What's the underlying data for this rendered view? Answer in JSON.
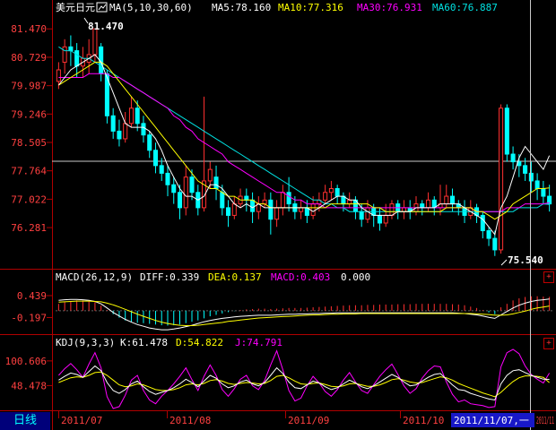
{
  "main": {
    "title": "美元日元",
    "ma_label": "MA(5,10,30,60)",
    "ma5": "MA5:78.160",
    "ma10": "MA10:77.316",
    "ma30": "MA30:76.931",
    "ma60": "MA60:76.887",
    "y_ticks": [
      "81.470",
      "80.729",
      "79.987",
      "79.246",
      "78.505",
      "77.764",
      "77.022",
      "76.281"
    ],
    "high_label": "81.470",
    "low_label": "75.540",
    "ylim": [
      75.3,
      81.85
    ]
  },
  "macd": {
    "label": "MACD(26,12,9)",
    "diff": "DIFF:0.339",
    "dea": "DEA:0.137",
    "macd_val": "MACD:0.403",
    "zero": "0.000",
    "y_ticks": [
      "0.439",
      "-0.197"
    ],
    "ylim": [
      -0.6,
      0.75
    ]
  },
  "kdj": {
    "label": "KDJ(9,3,3)",
    "k": "K:61.478",
    "d": "D:54.822",
    "j": "J:74.791",
    "y_ticks": [
      "100.606",
      "48.478"
    ],
    "ylim": [
      0,
      125
    ]
  },
  "footer": {
    "period_tab": "日线",
    "dates": [
      "2011/07",
      "2011/08",
      "2011/09",
      "2011/10",
      "2011/11"
    ],
    "cursor_date": "2011/11/07,一"
  },
  "panel_buttons": {
    "expand": "+"
  },
  "colors": {
    "up": "#ff3030",
    "down": "#00ffff",
    "ma5": "#ffffff",
    "ma10": "#ffff00",
    "ma30": "#ff00ff",
    "ma60": "#00e0e0",
    "axis": "#b00000",
    "title": "#ffffff"
  },
  "chart_data": {
    "type": "candlestick",
    "ohlc": [
      [
        80.1,
        80.4,
        79.9,
        80.6
      ],
      [
        80.6,
        81.0,
        80.3,
        81.2
      ],
      [
        81.0,
        80.9,
        80.5,
        81.3
      ],
      [
        80.9,
        80.5,
        80.2,
        81.1
      ],
      [
        80.5,
        80.7,
        80.2,
        81.0
      ],
      [
        80.6,
        80.8,
        80.3,
        81.2
      ],
      [
        80.8,
        81.47,
        80.6,
        81.47
      ],
      [
        81.0,
        80.3,
        80.1,
        81.1
      ],
      [
        80.3,
        79.2,
        79.0,
        80.4
      ],
      [
        79.2,
        78.8,
        78.6,
        79.4
      ],
      [
        78.8,
        78.6,
        78.4,
        79.1
      ],
      [
        78.6,
        79.0,
        78.5,
        79.3
      ],
      [
        79.0,
        79.4,
        78.9,
        79.7
      ],
      [
        79.4,
        79.0,
        78.8,
        79.6
      ],
      [
        79.0,
        78.7,
        78.5,
        79.2
      ],
      [
        78.7,
        78.3,
        78.1,
        78.8
      ],
      [
        78.3,
        77.9,
        77.7,
        78.5
      ],
      [
        77.9,
        77.7,
        77.5,
        78.1
      ],
      [
        77.7,
        77.4,
        77.1,
        77.9
      ],
      [
        77.4,
        77.2,
        76.9,
        77.6
      ],
      [
        77.2,
        76.8,
        76.5,
        77.4
      ],
      [
        76.8,
        77.6,
        76.6,
        77.9
      ],
      [
        77.6,
        77.2,
        77.0,
        77.8
      ],
      [
        77.2,
        76.8,
        76.6,
        77.4
      ],
      [
        76.8,
        77.5,
        76.7,
        79.7
      ],
      [
        77.5,
        77.8,
        77.3,
        78.0
      ],
      [
        77.6,
        77.3,
        77.0,
        77.9
      ],
      [
        77.2,
        76.8,
        76.6,
        77.4
      ],
      [
        76.8,
        76.6,
        76.3,
        77.0
      ],
      [
        76.6,
        76.9,
        76.5,
        77.1
      ],
      [
        76.9,
        77.1,
        76.8,
        77.3
      ],
      [
        77.1,
        77.0,
        76.7,
        77.3
      ],
      [
        77.0,
        76.7,
        76.4,
        77.2
      ],
      [
        76.7,
        76.9,
        76.5,
        77.1
      ],
      [
        76.9,
        77.0,
        76.8,
        77.2
      ],
      [
        77.0,
        76.5,
        76.1,
        77.2
      ],
      [
        76.5,
        76.8,
        76.3,
        77.0
      ],
      [
        76.8,
        77.2,
        76.6,
        77.4
      ],
      [
        77.2,
        76.9,
        76.7,
        77.6
      ],
      [
        76.9,
        76.7,
        76.5,
        77.1
      ],
      [
        76.7,
        76.8,
        76.5,
        77.0
      ],
      [
        76.8,
        76.6,
        76.4,
        77.0
      ],
      [
        76.6,
        76.9,
        76.5,
        77.1
      ],
      [
        76.9,
        77.0,
        76.7,
        77.2
      ],
      [
        77.0,
        77.2,
        76.9,
        77.4
      ],
      [
        77.2,
        77.3,
        77.0,
        77.5
      ],
      [
        77.3,
        77.1,
        76.9,
        77.4
      ],
      [
        77.1,
        76.9,
        76.7,
        77.2
      ],
      [
        76.9,
        77.0,
        76.8,
        77.2
      ],
      [
        77.0,
        76.7,
        76.5,
        77.1
      ],
      [
        76.7,
        76.5,
        76.3,
        76.9
      ],
      [
        76.5,
        76.8,
        76.4,
        77.0
      ],
      [
        76.8,
        76.6,
        76.3,
        76.9
      ],
      [
        76.6,
        76.4,
        76.2,
        76.8
      ],
      [
        76.4,
        76.6,
        76.3,
        76.9
      ],
      [
        76.6,
        76.9,
        76.5,
        77.0
      ],
      [
        76.9,
        76.7,
        76.5,
        77.0
      ],
      [
        76.7,
        76.8,
        76.5,
        77.0
      ],
      [
        76.8,
        76.7,
        76.5,
        77.0
      ],
      [
        76.7,
        76.9,
        76.6,
        77.1
      ],
      [
        76.9,
        76.8,
        76.6,
        77.0
      ],
      [
        76.8,
        77.0,
        76.7,
        77.2
      ],
      [
        77.0,
        76.8,
        76.6,
        77.1
      ],
      [
        76.8,
        76.9,
        76.6,
        77.4
      ],
      [
        76.9,
        77.1,
        76.8,
        77.4
      ],
      [
        77.1,
        76.9,
        76.7,
        77.3
      ],
      [
        76.9,
        76.8,
        76.6,
        77.0
      ],
      [
        76.8,
        76.6,
        76.4,
        77.0
      ],
      [
        76.6,
        76.8,
        76.5,
        77.0
      ],
      [
        76.8,
        76.6,
        76.4,
        76.9
      ],
      [
        76.6,
        76.2,
        76.0,
        76.7
      ],
      [
        76.2,
        76.0,
        75.8,
        76.3
      ],
      [
        76.0,
        75.7,
        75.54,
        76.2
      ],
      [
        75.7,
        79.4,
        75.6,
        79.5
      ],
      [
        79.4,
        78.2,
        78.0,
        79.5
      ],
      [
        78.2,
        78.0,
        77.8,
        78.4
      ],
      [
        78.0,
        77.9,
        77.6,
        78.2
      ],
      [
        77.9,
        77.7,
        77.5,
        78.1
      ],
      [
        77.7,
        77.5,
        77.2,
        78.0
      ],
      [
        77.5,
        77.3,
        77.0,
        77.7
      ],
      [
        77.3,
        77.1,
        76.9,
        77.5
      ],
      [
        77.1,
        76.9,
        76.7,
        77.4
      ]
    ],
    "ma5": [
      80.0,
      80.2,
      80.4,
      80.5,
      80.6,
      80.7,
      80.8,
      80.6,
      80.2,
      79.8,
      79.4,
      79.0,
      78.9,
      78.9,
      78.9,
      78.8,
      78.6,
      78.3,
      77.9,
      77.6,
      77.3,
      77.1,
      77.1,
      77.0,
      77.1,
      77.4,
      77.4,
      77.3,
      77.1,
      76.9,
      76.8,
      76.9,
      76.8,
      76.9,
      76.8,
      76.8,
      76.8,
      76.8,
      76.8,
      76.8,
      76.8,
      76.8,
      76.7,
      76.8,
      76.9,
      77.0,
      77.1,
      77.1,
      77.0,
      77.0,
      76.8,
      76.7,
      76.6,
      76.6,
      76.6,
      76.6,
      76.7,
      76.7,
      76.7,
      76.8,
      76.8,
      76.8,
      76.8,
      76.9,
      76.9,
      76.9,
      76.9,
      76.8,
      76.7,
      76.6,
      76.5,
      76.3,
      76.1,
      76.8,
      77.1,
      77.6,
      78.1,
      78.4,
      78.2,
      78.0,
      77.8,
      78.16
    ],
    "ma10": [
      80.0,
      80.1,
      80.2,
      80.3,
      80.4,
      80.5,
      80.6,
      80.6,
      80.5,
      80.3,
      80.1,
      79.9,
      79.7,
      79.5,
      79.3,
      79.1,
      78.9,
      78.7,
      78.5,
      78.3,
      78.1,
      77.9,
      77.7,
      77.5,
      77.4,
      77.3,
      77.3,
      77.2,
      77.1,
      77.1,
      77.0,
      77.0,
      77.0,
      76.9,
      76.9,
      76.8,
      76.8,
      76.8,
      76.8,
      76.8,
      76.8,
      76.8,
      76.8,
      76.8,
      76.8,
      76.9,
      76.9,
      76.9,
      76.9,
      76.9,
      76.9,
      76.9,
      76.8,
      76.8,
      76.7,
      76.7,
      76.7,
      76.7,
      76.7,
      76.7,
      76.7,
      76.7,
      76.7,
      76.7,
      76.8,
      76.8,
      76.8,
      76.8,
      76.8,
      76.7,
      76.7,
      76.6,
      76.5,
      76.6,
      76.7,
      76.9,
      77.0,
      77.1,
      77.2,
      77.3,
      77.3,
      77.316
    ],
    "ma30": [
      80.2,
      80.2,
      80.2,
      80.2,
      80.2,
      80.3,
      80.3,
      80.3,
      80.3,
      80.2,
      80.2,
      80.1,
      80.0,
      79.9,
      79.8,
      79.7,
      79.6,
      79.5,
      79.4,
      79.2,
      79.1,
      78.9,
      78.8,
      78.6,
      78.5,
      78.4,
      78.3,
      78.2,
      78.0,
      77.9,
      77.8,
      77.7,
      77.6,
      77.5,
      77.4,
      77.3,
      77.2,
      77.2,
      77.1,
      77.0,
      77.0,
      76.9,
      76.9,
      76.9,
      76.8,
      76.8,
      76.8,
      76.8,
      76.8,
      76.8,
      76.8,
      76.8,
      76.8,
      76.8,
      76.8,
      76.8,
      76.8,
      76.8,
      76.8,
      76.8,
      76.8,
      76.8,
      76.8,
      76.8,
      76.8,
      76.8,
      76.8,
      76.8,
      76.8,
      76.7,
      76.7,
      76.7,
      76.7,
      76.7,
      76.8,
      76.8,
      76.8,
      76.9,
      76.9,
      76.9,
      76.9,
      76.931
    ],
    "ma60": [
      81.0,
      80.9,
      80.9,
      80.8,
      80.7,
      80.7,
      80.6,
      80.5,
      80.4,
      80.3,
      80.2,
      80.1,
      80.0,
      79.9,
      79.8,
      79.7,
      79.6,
      79.5,
      79.4,
      79.3,
      79.2,
      79.1,
      79.0,
      78.9,
      78.8,
      78.7,
      78.6,
      78.5,
      78.4,
      78.3,
      78.2,
      78.1,
      78.0,
      77.9,
      77.8,
      77.7,
      77.6,
      77.5,
      77.4,
      77.3,
      77.2,
      77.1,
      77.0,
      77.0,
      76.9,
      76.9,
      76.8,
      76.8,
      76.7,
      76.7,
      76.7,
      76.7,
      76.7,
      76.7,
      76.7,
      76.7,
      76.7,
      76.7,
      76.7,
      76.7,
      76.7,
      76.7,
      76.7,
      76.7,
      76.7,
      76.7,
      76.7,
      76.7,
      76.7,
      76.7,
      76.7,
      76.7,
      76.7,
      76.7,
      76.7,
      76.7,
      76.8,
      76.8,
      76.8,
      76.8,
      76.9,
      76.887
    ],
    "macd_hist": [
      0.2,
      0.25,
      0.28,
      0.3,
      0.3,
      0.28,
      0.25,
      0.15,
      0.02,
      -0.1,
      -0.2,
      -0.28,
      -0.32,
      -0.35,
      -0.36,
      -0.38,
      -0.4,
      -0.42,
      -0.43,
      -0.42,
      -0.4,
      -0.36,
      -0.32,
      -0.28,
      -0.22,
      -0.16,
      -0.12,
      -0.08,
      -0.04,
      -0.01,
      0.02,
      0.04,
      0.05,
      0.06,
      0.06,
      0.05,
      0.06,
      0.07,
      0.08,
      0.08,
      0.08,
      0.09,
      0.1,
      0.11,
      0.12,
      0.13,
      0.14,
      0.15,
      0.16,
      0.16,
      0.16,
      0.17,
      0.17,
      0.18,
      0.18,
      0.18,
      0.19,
      0.19,
      0.19,
      0.2,
      0.2,
      0.2,
      0.2,
      0.2,
      0.2,
      0.19,
      0.18,
      0.16,
      0.12,
      0.08,
      0.02,
      -0.05,
      -0.1,
      0.1,
      0.2,
      0.3,
      0.36,
      0.4,
      0.42,
      0.42,
      0.41,
      0.403
    ],
    "macd_diff": [
      0.3,
      0.32,
      0.33,
      0.33,
      0.32,
      0.3,
      0.27,
      0.2,
      0.08,
      -0.05,
      -0.15,
      -0.25,
      -0.33,
      -0.4,
      -0.45,
      -0.5,
      -0.53,
      -0.55,
      -0.55,
      -0.53,
      -0.5,
      -0.46,
      -0.42,
      -0.37,
      -0.32,
      -0.28,
      -0.25,
      -0.22,
      -0.2,
      -0.18,
      -0.16,
      -0.15,
      -0.14,
      -0.13,
      -0.13,
      -0.13,
      -0.12,
      -0.11,
      -0.1,
      -0.1,
      -0.09,
      -0.09,
      -0.08,
      -0.08,
      -0.07,
      -0.07,
      -0.06,
      -0.06,
      -0.06,
      -0.06,
      -0.06,
      -0.06,
      -0.06,
      -0.06,
      -0.06,
      -0.06,
      -0.06,
      -0.06,
      -0.06,
      -0.06,
      -0.06,
      -0.06,
      -0.06,
      -0.06,
      -0.06,
      -0.06,
      -0.07,
      -0.08,
      -0.1,
      -0.12,
      -0.15,
      -0.19,
      -0.22,
      -0.12,
      -0.02,
      0.08,
      0.16,
      0.22,
      0.27,
      0.3,
      0.32,
      0.339
    ],
    "macd_dea": [
      0.25,
      0.26,
      0.27,
      0.28,
      0.28,
      0.28,
      0.27,
      0.26,
      0.22,
      0.17,
      0.11,
      0.04,
      -0.03,
      -0.1,
      -0.16,
      -0.22,
      -0.28,
      -0.33,
      -0.37,
      -0.4,
      -0.42,
      -0.43,
      -0.43,
      -0.42,
      -0.4,
      -0.38,
      -0.36,
      -0.34,
      -0.31,
      -0.29,
      -0.27,
      -0.25,
      -0.23,
      -0.21,
      -0.2,
      -0.19,
      -0.18,
      -0.17,
      -0.16,
      -0.15,
      -0.14,
      -0.13,
      -0.12,
      -0.12,
      -0.11,
      -0.1,
      -0.1,
      -0.09,
      -0.09,
      -0.09,
      -0.08,
      -0.08,
      -0.08,
      -0.08,
      -0.08,
      -0.08,
      -0.08,
      -0.08,
      -0.08,
      -0.08,
      -0.08,
      -0.08,
      -0.08,
      -0.08,
      -0.08,
      -0.08,
      -0.08,
      -0.08,
      -0.08,
      -0.09,
      -0.1,
      -0.11,
      -0.13,
      -0.13,
      -0.12,
      -0.09,
      -0.05,
      -0.01,
      0.04,
      0.08,
      0.11,
      0.137
    ],
    "kdj_k": [
      60,
      68,
      75,
      72,
      66,
      78,
      90,
      80,
      55,
      38,
      32,
      40,
      52,
      58,
      46,
      36,
      30,
      34,
      38,
      44,
      52,
      62,
      55,
      46,
      58,
      70,
      64,
      52,
      44,
      48,
      56,
      60,
      52,
      48,
      55,
      70,
      86,
      74,
      56,
      44,
      42,
      50,
      58,
      54,
      46,
      40,
      44,
      52,
      60,
      54,
      46,
      42,
      48,
      56,
      64,
      72,
      66,
      56,
      48,
      50,
      58,
      66,
      72,
      74,
      62,
      50,
      40,
      38,
      32,
      28,
      24,
      20,
      18,
      52,
      70,
      80,
      82,
      76,
      70,
      66,
      62,
      61.478
    ],
    "kdj_d": [
      55,
      60,
      65,
      67,
      66,
      70,
      76,
      77,
      70,
      60,
      50,
      46,
      48,
      52,
      50,
      45,
      40,
      38,
      38,
      40,
      44,
      50,
      52,
      50,
      53,
      59,
      61,
      58,
      53,
      51,
      53,
      55,
      54,
      52,
      53,
      59,
      68,
      70,
      65,
      58,
      52,
      51,
      53,
      54,
      51,
      47,
      46,
      48,
      52,
      53,
      50,
      47,
      47,
      50,
      55,
      61,
      63,
      60,
      56,
      54,
      55,
      59,
      63,
      67,
      65,
      60,
      53,
      48,
      43,
      38,
      33,
      29,
      25,
      34,
      46,
      57,
      65,
      69,
      69,
      68,
      66,
      54.822
    ],
    "kdj_j": [
      70,
      84,
      95,
      82,
      66,
      94,
      118,
      86,
      25,
      -6,
      4,
      28,
      60,
      70,
      38,
      18,
      10,
      26,
      38,
      52,
      68,
      86,
      61,
      38,
      68,
      92,
      70,
      40,
      26,
      42,
      62,
      70,
      48,
      40,
      59,
      92,
      122,
      82,
      38,
      16,
      22,
      48,
      68,
      54,
      36,
      26,
      40,
      60,
      76,
      56,
      38,
      32,
      50,
      68,
      82,
      94,
      72,
      48,
      32,
      42,
      64,
      80,
      90,
      88,
      56,
      30,
      14,
      18,
      10,
      8,
      6,
      2,
      4,
      88,
      118,
      126,
      116,
      90,
      72,
      62,
      54,
      74.791
    ]
  }
}
